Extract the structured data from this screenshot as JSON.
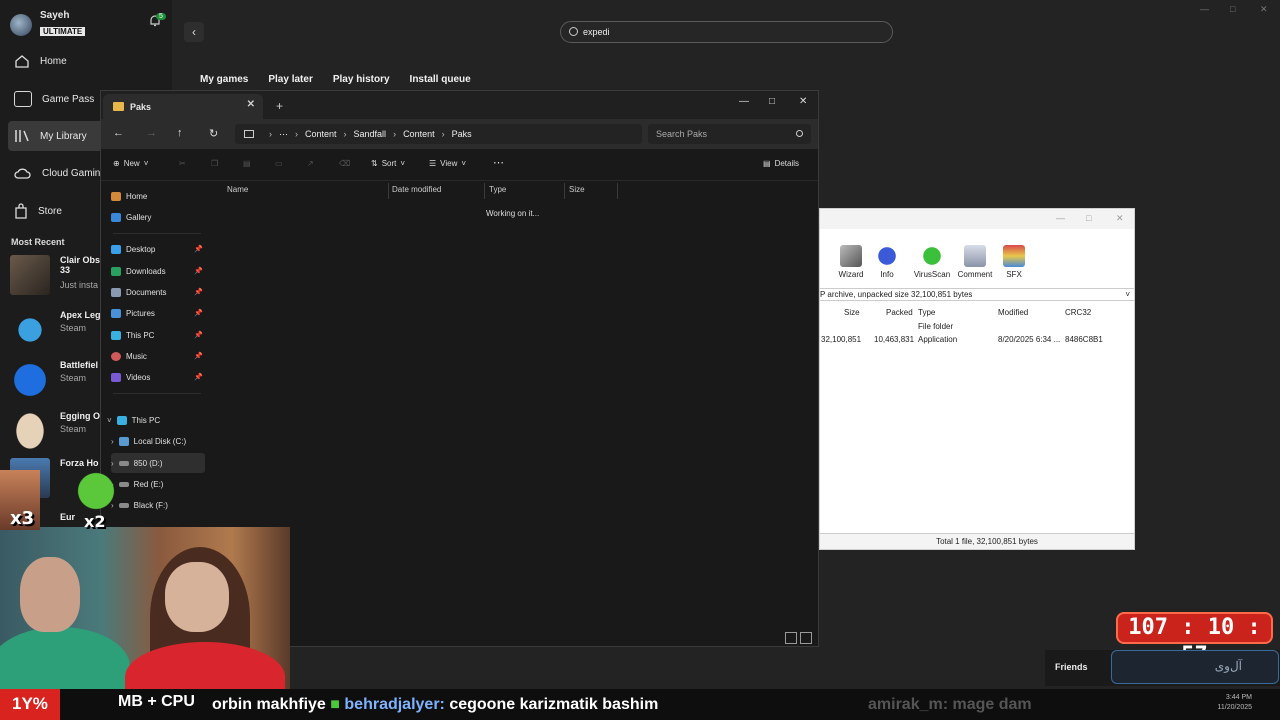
{
  "xbox": {
    "user_name": "Sayeh",
    "user_badge": "ULTIMATE",
    "notification_count": "5",
    "nav": [
      {
        "label": "Home"
      },
      {
        "label": "Game Pass"
      },
      {
        "label": "My Library"
      },
      {
        "label": "Cloud Gaming"
      },
      {
        "label": "Store"
      }
    ],
    "most_recent_title": "Most Recent",
    "recent": [
      {
        "name": "Clair Obs 33",
        "sub": "Just insta"
      },
      {
        "name": "Apex Leg",
        "sub": "Steam"
      },
      {
        "name": "Battlefiel",
        "sub": "Steam"
      },
      {
        "name": "Egging O",
        "sub": "Steam"
      },
      {
        "name": "Forza Ho",
        "sub": ""
      },
      {
        "name": "Eur",
        "sub": ""
      }
    ],
    "search_value": "expedi",
    "tabs": [
      "My games",
      "Play later",
      "Play history",
      "Install queue"
    ],
    "friends_label": "Friends",
    "friends_search": "آل‌وی"
  },
  "explorer": {
    "tab_title": "Paks",
    "breadcrumb": [
      "Content",
      "Sandfall",
      "Content",
      "Paks"
    ],
    "search_placeholder": "Search Paks",
    "cmd": {
      "new": "New",
      "sort": "Sort",
      "view": "View",
      "details": "Details"
    },
    "nav_quick": [
      {
        "label": "Home"
      },
      {
        "label": "Gallery"
      }
    ],
    "nav_pinned": [
      {
        "label": "Desktop"
      },
      {
        "label": "Downloads"
      },
      {
        "label": "Documents"
      },
      {
        "label": "Pictures"
      },
      {
        "label": "This PC"
      },
      {
        "label": "Music"
      },
      {
        "label": "Videos"
      }
    ],
    "nav_pc": [
      {
        "label": "This PC"
      },
      {
        "label": "Local Disk (C:)"
      },
      {
        "label": "850 (D:)"
      },
      {
        "label": "Red (E:)"
      },
      {
        "label": "Black (F:)"
      }
    ],
    "columns": [
      "Name",
      "Date modified",
      "Type",
      "Size"
    ],
    "status": "Working on it..."
  },
  "winrar": {
    "toolbar": [
      "Wizard",
      "Info",
      "VirusScan",
      "Comment",
      "SFX"
    ],
    "path_text": "P archive, unpacked size 32,100,851 bytes",
    "columns": [
      "Size",
      "Packed",
      "Type",
      "Modified",
      "CRC32"
    ],
    "rows": [
      {
        "size": "",
        "packed": "",
        "type": "File folder",
        "modified": "",
        "crc": ""
      },
      {
        "size": "32,100,851",
        "packed": "10,463,831",
        "type": "Application",
        "modified": "8/20/2025 6:34 ...",
        "crc": "8486C8B1"
      }
    ],
    "status": "Total 1 file, 32,100,851 bytes"
  },
  "overlay": {
    "timer": "107 : 10 : 57",
    "percent": "1Y%",
    "cpu_label": "MB + CPU",
    "ticker_prefix": "orbin makhfiye",
    "ticker_user": "behradjalyer:",
    "ticker_text": "cegoone karizmatik bashim",
    "ticker_next": "amirak_m: mage dam",
    "meme_x3": "x3",
    "meme_x2": "x2",
    "clock_time": "3:44 PM",
    "clock_date": "11/20/2025"
  }
}
